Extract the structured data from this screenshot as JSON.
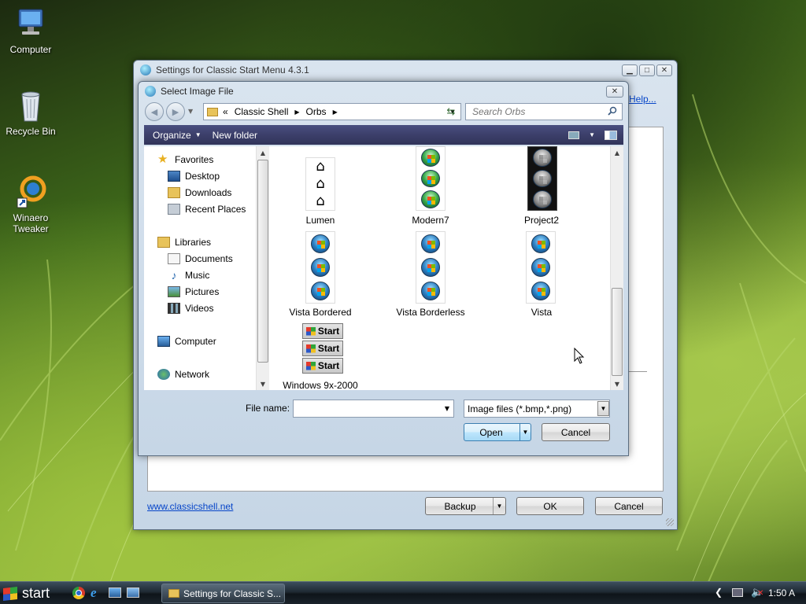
{
  "desktop": {
    "icons": [
      {
        "label": "Computer"
      },
      {
        "label": "Recycle Bin"
      },
      {
        "label": "Winaero Tweaker"
      }
    ]
  },
  "settings_window": {
    "title": "Settings for Classic Start Menu 4.3.1",
    "help_link": "Help...",
    "website_link": "www.classicshell.net",
    "backup_label": "Backup",
    "ok_label": "OK",
    "cancel_label": "Cancel"
  },
  "dialog": {
    "title": "Select Image File",
    "breadcrumb": {
      "prefix": "«",
      "parts": [
        "Classic Shell",
        "Orbs"
      ]
    },
    "search_placeholder": "Search Orbs",
    "toolbar": {
      "organize": "Organize",
      "new_folder": "New folder"
    },
    "nav": {
      "favorites": "Favorites",
      "desktop": "Desktop",
      "downloads": "Downloads",
      "recent_places": "Recent Places",
      "libraries": "Libraries",
      "documents": "Documents",
      "music": "Music",
      "pictures": "Pictures",
      "videos": "Videos",
      "computer": "Computer",
      "network": "Network"
    },
    "files": {
      "lumen": "Lumen",
      "modern7": "Modern7",
      "project2": "Project2",
      "vista_bordered": "Vista Bordered",
      "vista_borderless": "Vista Borderless",
      "vista": "Vista",
      "win9x": "Windows 9x-2000",
      "start_text": "Start"
    },
    "file_name_label": "File name:",
    "file_name_value": "",
    "file_type": "Image files (*.bmp,*.png)",
    "open_label": "Open",
    "cancel_label": "Cancel"
  },
  "taskbar": {
    "start_label": "start",
    "task_label": "Settings for Classic S...",
    "clock": "1:50 A"
  }
}
